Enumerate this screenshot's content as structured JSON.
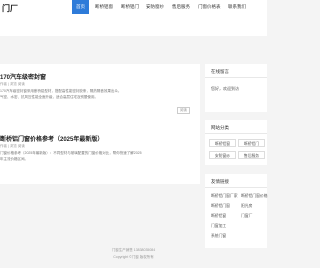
{
  "header": {
    "logo": "门厂",
    "nav": [
      "首页",
      "断桥铝窗",
      "断桥铝门",
      "安防窗纱",
      "售后服务",
      "门窗价格表",
      "联系我们"
    ]
  },
  "articles": [
    {
      "title": "170汽车级密封窗",
      "meta": "作者 | 浏览 阅读",
      "lines": [
        "170汽车级密封窗采用断桥铝型材，搭配高性能密封胶条，隔热隔音效果出众。",
        "气密、水密、抗风压性能全面升级，适合高层住宅及别墅使用。"
      ],
      "more": "阅读"
    },
    {
      "title": "断桥铝门窗价格参考（2025年最新版）",
      "meta": "作者 | 浏览 阅读",
      "lines": [
        "门窗价格参考（2025年最新版）：不同型材与玻璃配置的门窗价格对比，帮你快速了解2025",
        "年主流价格区间。"
      ],
      "more": "阅读"
    }
  ],
  "sidebar": {
    "contact_title": "在线留言",
    "contact_text": "您好，欢迎到访",
    "categories_title": "网站分类",
    "categories": [
      "断桥铝窗",
      "断桥铝门",
      "安防窗纱",
      "售后服务"
    ],
    "links_title": "友情链接",
    "links": [
      "断桥铝门窗厂家",
      "断桥铝门窗",
      "断桥铝窗",
      "门窗加工",
      "系统门窗",
      "断桥铝门窗价格",
      "阳光房",
      "门窗厂"
    ]
  },
  "footer": {
    "line1": "门窗生产销售 13838035084",
    "line2": "Copyright ©门窗 版权所有"
  },
  "colors": {
    "accent": "#2e7bd9",
    "background": "#f4f4f4",
    "panel": "#ffffff"
  }
}
